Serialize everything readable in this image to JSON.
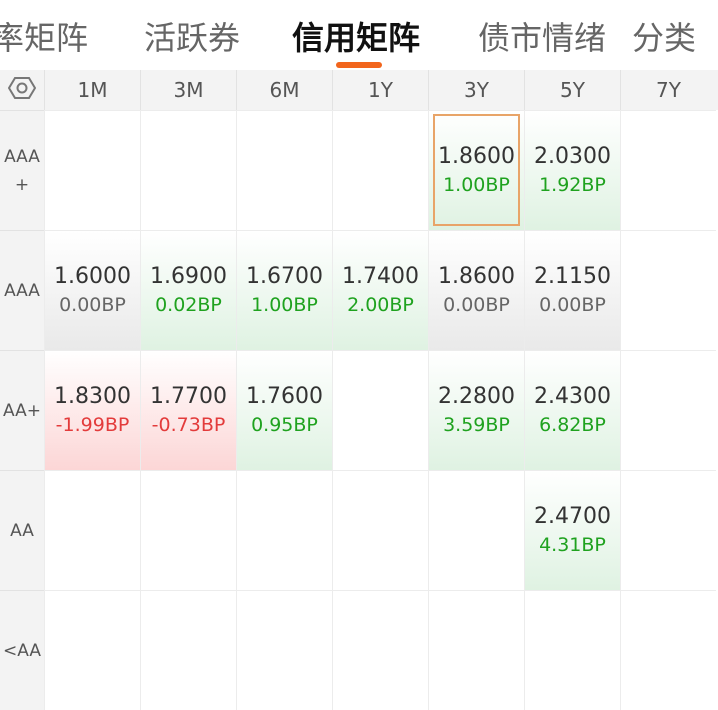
{
  "tabs": [
    {
      "label": "率矩阵",
      "active": false
    },
    {
      "label": "活跃券",
      "active": false
    },
    {
      "label": "信用矩阵",
      "active": true
    },
    {
      "label": "债市情绪",
      "active": false
    },
    {
      "label": "分类",
      "active": false
    }
  ],
  "colors": {
    "accent": "#f2651c",
    "positive": "#1fa21f",
    "negative": "#e33b3b"
  },
  "header": {
    "settings_icon": "hexagon-settings-icon",
    "tenors": [
      "1M",
      "3M",
      "6M",
      "1Y",
      "3Y",
      "5Y",
      "7Y"
    ]
  },
  "rows": [
    {
      "rating": "AAA\n+",
      "cells": [
        null,
        null,
        null,
        null,
        {
          "value": "1.8600",
          "bp": "1.00BP",
          "tone": "green",
          "selected": true
        },
        {
          "value": "2.0300",
          "bp": "1.92BP",
          "tone": "green"
        },
        null
      ]
    },
    {
      "rating": "AAA",
      "cells": [
        {
          "value": "1.6000",
          "bp": "0.00BP",
          "tone": "gray"
        },
        {
          "value": "1.6900",
          "bp": "0.02BP",
          "tone": "green"
        },
        {
          "value": "1.6700",
          "bp": "1.00BP",
          "tone": "green"
        },
        {
          "value": "1.7400",
          "bp": "2.00BP",
          "tone": "green"
        },
        {
          "value": "1.8600",
          "bp": "0.00BP",
          "tone": "gray"
        },
        {
          "value": "2.1150",
          "bp": "0.00BP",
          "tone": "gray"
        },
        null
      ]
    },
    {
      "rating": "AA+",
      "cells": [
        {
          "value": "1.8300",
          "bp": "-1.99BP",
          "tone": "red"
        },
        {
          "value": "1.7700",
          "bp": "-0.73BP",
          "tone": "red"
        },
        {
          "value": "1.7600",
          "bp": "0.95BP",
          "tone": "green"
        },
        null,
        {
          "value": "2.2800",
          "bp": "3.59BP",
          "tone": "green"
        },
        {
          "value": "2.4300",
          "bp": "6.82BP",
          "tone": "green"
        },
        null
      ]
    },
    {
      "rating": "AA",
      "cells": [
        null,
        null,
        null,
        null,
        null,
        {
          "value": "2.4700",
          "bp": "4.31BP",
          "tone": "green"
        },
        null
      ]
    },
    {
      "rating": "<AA",
      "cells": [
        null,
        null,
        null,
        null,
        null,
        null,
        null
      ]
    }
  ]
}
